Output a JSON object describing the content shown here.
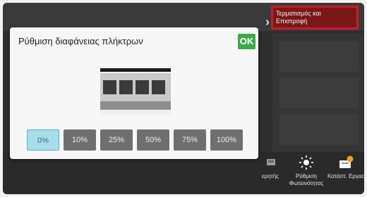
{
  "header": {
    "return_label_line1": "Τερματισμός και",
    "return_label_line2": "Επιστροφή",
    "chevron": "›"
  },
  "dialog": {
    "title": "Ρύθμιση διαφάνειας πλήκτρων",
    "ok_label": "OK",
    "options": [
      "0%",
      "10%",
      "25%",
      "50%",
      "75%",
      "100%"
    ],
    "selected_index": 0
  },
  "bottom_bar": {
    "items": [
      {
        "label": "ερητής",
        "icon": "scanner-icon"
      },
      {
        "label": "Ρύθμιση",
        "label2": "Φωτεινότητας",
        "icon": "brightness-icon"
      },
      {
        "label": "Κατάστ. Εργασ.",
        "icon": "job-status-icon"
      }
    ]
  },
  "colors": {
    "ok_green": "#3aaa4a",
    "highlight_red": "#c61d2b",
    "selected_blue": "#a9dde9",
    "job_badge_orange": "#f0a020"
  }
}
